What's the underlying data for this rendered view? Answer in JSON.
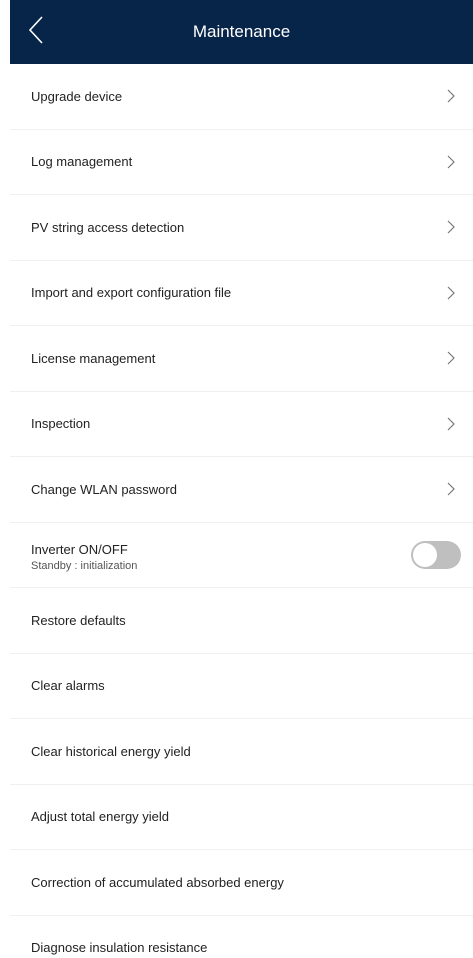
{
  "header": {
    "title": "Maintenance",
    "background_color": "#072548",
    "back_icon": "chevron-left-icon"
  },
  "menu": {
    "items": [
      {
        "label": "Upgrade device",
        "has_chevron": true
      },
      {
        "label": "Log management",
        "has_chevron": true
      },
      {
        "label": "PV string access detection",
        "has_chevron": true
      },
      {
        "label": "Import and export configuration file",
        "has_chevron": true
      },
      {
        "label": "License management",
        "has_chevron": true
      },
      {
        "label": "Inspection",
        "has_chevron": true
      },
      {
        "label": "Change WLAN password",
        "has_chevron": true
      }
    ],
    "inverter": {
      "label": "Inverter ON/OFF",
      "status": "Standby : initialization",
      "toggle_on": false
    },
    "actions": [
      {
        "label": "Restore defaults"
      },
      {
        "label": "Clear alarms"
      },
      {
        "label": "Clear historical energy yield"
      },
      {
        "label": "Adjust total energy yield"
      },
      {
        "label": "Correction of accumulated absorbed energy"
      },
      {
        "label": "Diagnose insulation resistance"
      }
    ]
  },
  "colors": {
    "toggle_off": "#bfbfbf",
    "divider": "#f0f0f0",
    "chevron": "#777777"
  }
}
